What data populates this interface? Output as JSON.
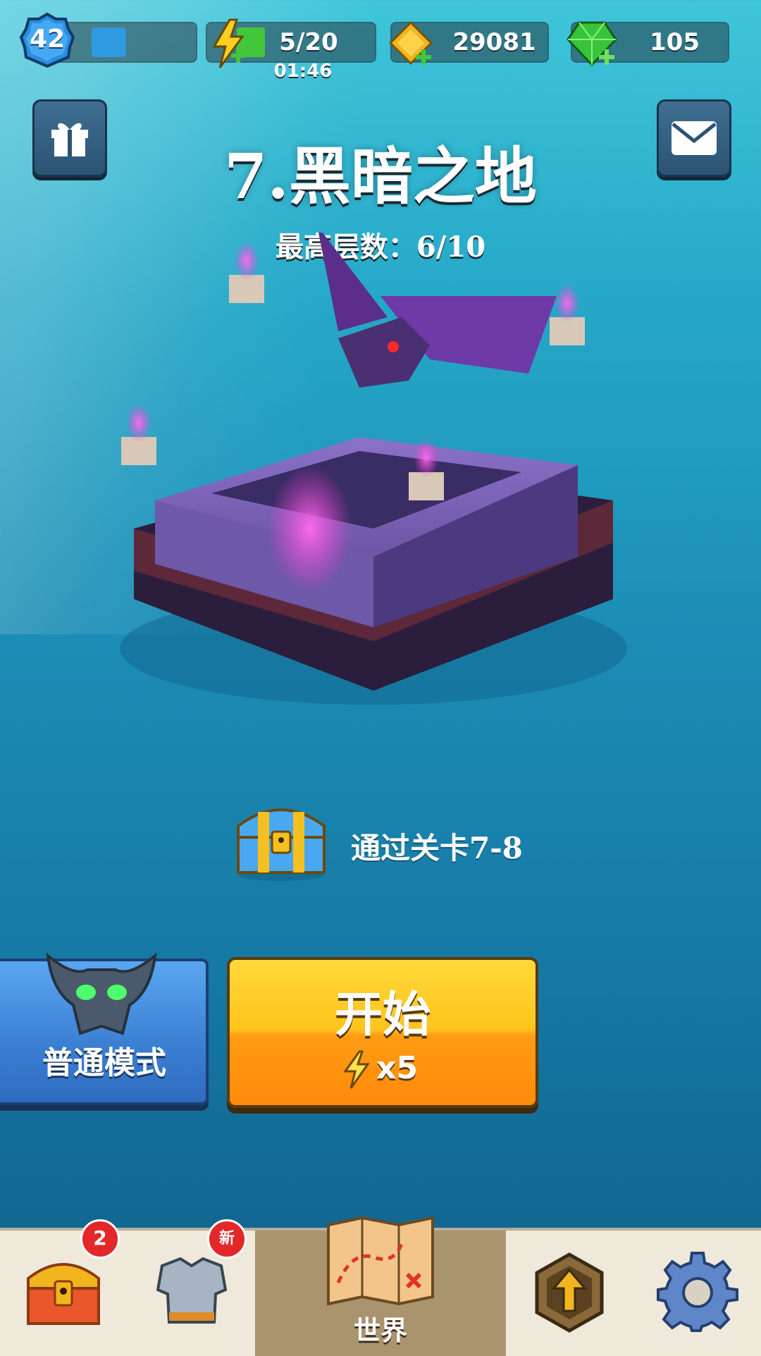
{
  "player": {
    "level": "42",
    "xp_fraction": 0.35
  },
  "resources": {
    "energy": {
      "value": "5/20",
      "timer": "01:46"
    },
    "coins": {
      "value": "29081"
    },
    "gems": {
      "value": "105"
    }
  },
  "stage": {
    "title": "7.黑暗之地",
    "subtitle": "最高层数：6/10"
  },
  "reward": {
    "text": "通过关卡7-8"
  },
  "mode": {
    "label": "普通模式"
  },
  "start": {
    "label": "开始",
    "cost": "x5"
  },
  "nav": {
    "chest_badge": "2",
    "armor_badge": "新",
    "world_label": "世界"
  },
  "colors": {
    "start_top": "#ffd93a",
    "start_bottom": "#ff8a0c",
    "mode_blue": "#3b7fd2",
    "xp_blue": "#2f9ae0",
    "energy_green": "#43c63a",
    "badge_red": "#e22828"
  }
}
